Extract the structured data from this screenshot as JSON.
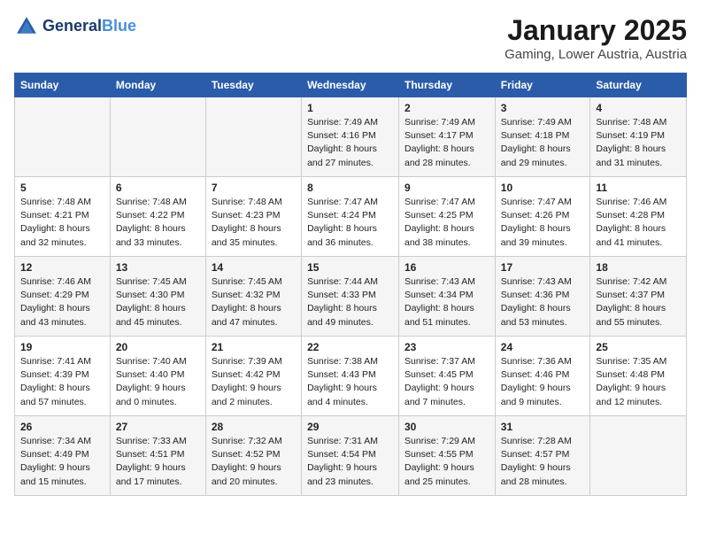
{
  "header": {
    "logo_line1": "General",
    "logo_line2": "Blue",
    "title": "January 2025",
    "subtitle": "Gaming, Lower Austria, Austria"
  },
  "days_of_week": [
    "Sunday",
    "Monday",
    "Tuesday",
    "Wednesday",
    "Thursday",
    "Friday",
    "Saturday"
  ],
  "weeks": [
    [
      {
        "day": "",
        "content": ""
      },
      {
        "day": "",
        "content": ""
      },
      {
        "day": "",
        "content": ""
      },
      {
        "day": "1",
        "content": "Sunrise: 7:49 AM\nSunset: 4:16 PM\nDaylight: 8 hours and 27 minutes."
      },
      {
        "day": "2",
        "content": "Sunrise: 7:49 AM\nSunset: 4:17 PM\nDaylight: 8 hours and 28 minutes."
      },
      {
        "day": "3",
        "content": "Sunrise: 7:49 AM\nSunset: 4:18 PM\nDaylight: 8 hours and 29 minutes."
      },
      {
        "day": "4",
        "content": "Sunrise: 7:48 AM\nSunset: 4:19 PM\nDaylight: 8 hours and 31 minutes."
      }
    ],
    [
      {
        "day": "5",
        "content": "Sunrise: 7:48 AM\nSunset: 4:21 PM\nDaylight: 8 hours and 32 minutes."
      },
      {
        "day": "6",
        "content": "Sunrise: 7:48 AM\nSunset: 4:22 PM\nDaylight: 8 hours and 33 minutes."
      },
      {
        "day": "7",
        "content": "Sunrise: 7:48 AM\nSunset: 4:23 PM\nDaylight: 8 hours and 35 minutes."
      },
      {
        "day": "8",
        "content": "Sunrise: 7:47 AM\nSunset: 4:24 PM\nDaylight: 8 hours and 36 minutes."
      },
      {
        "day": "9",
        "content": "Sunrise: 7:47 AM\nSunset: 4:25 PM\nDaylight: 8 hours and 38 minutes."
      },
      {
        "day": "10",
        "content": "Sunrise: 7:47 AM\nSunset: 4:26 PM\nDaylight: 8 hours and 39 minutes."
      },
      {
        "day": "11",
        "content": "Sunrise: 7:46 AM\nSunset: 4:28 PM\nDaylight: 8 hours and 41 minutes."
      }
    ],
    [
      {
        "day": "12",
        "content": "Sunrise: 7:46 AM\nSunset: 4:29 PM\nDaylight: 8 hours and 43 minutes."
      },
      {
        "day": "13",
        "content": "Sunrise: 7:45 AM\nSunset: 4:30 PM\nDaylight: 8 hours and 45 minutes."
      },
      {
        "day": "14",
        "content": "Sunrise: 7:45 AM\nSunset: 4:32 PM\nDaylight: 8 hours and 47 minutes."
      },
      {
        "day": "15",
        "content": "Sunrise: 7:44 AM\nSunset: 4:33 PM\nDaylight: 8 hours and 49 minutes."
      },
      {
        "day": "16",
        "content": "Sunrise: 7:43 AM\nSunset: 4:34 PM\nDaylight: 8 hours and 51 minutes."
      },
      {
        "day": "17",
        "content": "Sunrise: 7:43 AM\nSunset: 4:36 PM\nDaylight: 8 hours and 53 minutes."
      },
      {
        "day": "18",
        "content": "Sunrise: 7:42 AM\nSunset: 4:37 PM\nDaylight: 8 hours and 55 minutes."
      }
    ],
    [
      {
        "day": "19",
        "content": "Sunrise: 7:41 AM\nSunset: 4:39 PM\nDaylight: 8 hours and 57 minutes."
      },
      {
        "day": "20",
        "content": "Sunrise: 7:40 AM\nSunset: 4:40 PM\nDaylight: 9 hours and 0 minutes."
      },
      {
        "day": "21",
        "content": "Sunrise: 7:39 AM\nSunset: 4:42 PM\nDaylight: 9 hours and 2 minutes."
      },
      {
        "day": "22",
        "content": "Sunrise: 7:38 AM\nSunset: 4:43 PM\nDaylight: 9 hours and 4 minutes."
      },
      {
        "day": "23",
        "content": "Sunrise: 7:37 AM\nSunset: 4:45 PM\nDaylight: 9 hours and 7 minutes."
      },
      {
        "day": "24",
        "content": "Sunrise: 7:36 AM\nSunset: 4:46 PM\nDaylight: 9 hours and 9 minutes."
      },
      {
        "day": "25",
        "content": "Sunrise: 7:35 AM\nSunset: 4:48 PM\nDaylight: 9 hours and 12 minutes."
      }
    ],
    [
      {
        "day": "26",
        "content": "Sunrise: 7:34 AM\nSunset: 4:49 PM\nDaylight: 9 hours and 15 minutes."
      },
      {
        "day": "27",
        "content": "Sunrise: 7:33 AM\nSunset: 4:51 PM\nDaylight: 9 hours and 17 minutes."
      },
      {
        "day": "28",
        "content": "Sunrise: 7:32 AM\nSunset: 4:52 PM\nDaylight: 9 hours and 20 minutes."
      },
      {
        "day": "29",
        "content": "Sunrise: 7:31 AM\nSunset: 4:54 PM\nDaylight: 9 hours and 23 minutes."
      },
      {
        "day": "30",
        "content": "Sunrise: 7:29 AM\nSunset: 4:55 PM\nDaylight: 9 hours and 25 minutes."
      },
      {
        "day": "31",
        "content": "Sunrise: 7:28 AM\nSunset: 4:57 PM\nDaylight: 9 hours and 28 minutes."
      },
      {
        "day": "",
        "content": ""
      }
    ]
  ]
}
